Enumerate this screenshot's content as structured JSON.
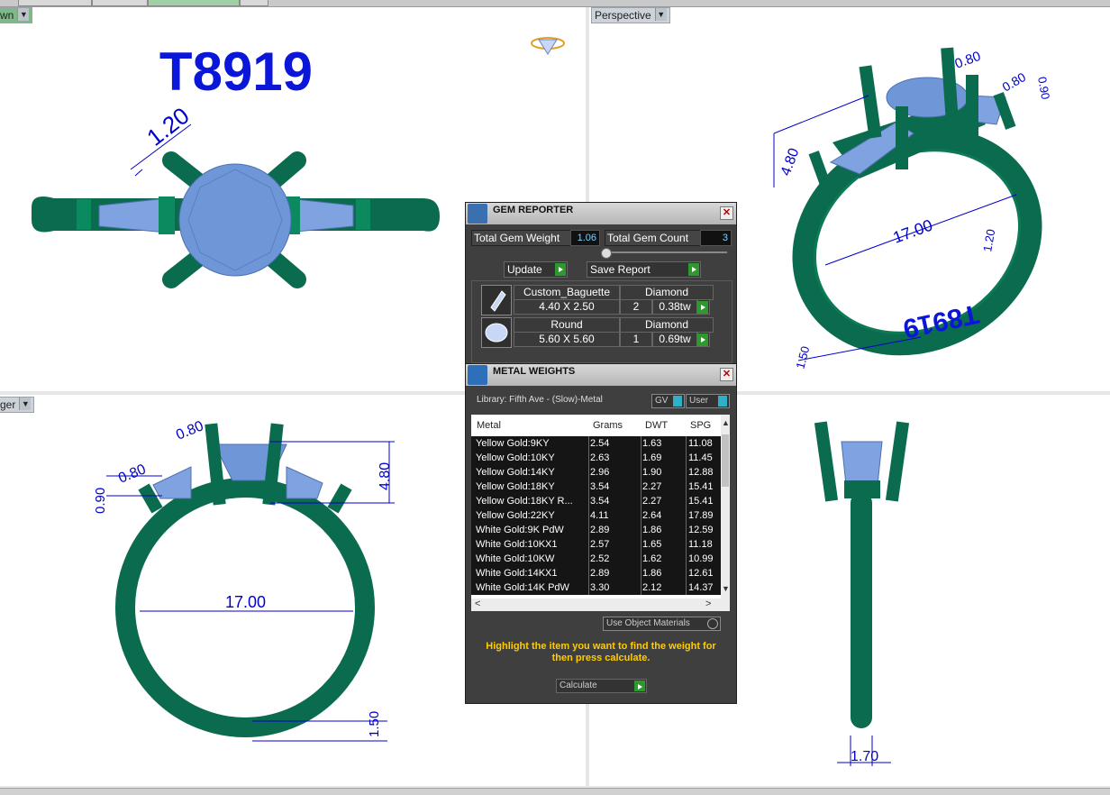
{
  "viewports": {
    "top_left": {
      "label": "wn",
      "part_number": "T8919"
    },
    "top_right": {
      "label": "Perspective",
      "engraving": "T8919"
    },
    "bottom_left": {
      "label": "ger"
    },
    "bottom_right": {}
  },
  "dimensions": {
    "prong_1": "1.20",
    "tr_prong_a": "0.80",
    "tr_prong_b": "0.80",
    "tr_prong_c": "0.90",
    "tr_height": "4.80",
    "tr_diameter": "17.00",
    "tr_shank_a": "1.20",
    "tr_shank_b": "1.50",
    "bl_prong_a": "0.80",
    "bl_prong_b": "0.80",
    "bl_prong_c": "0.90",
    "bl_height": "4.80",
    "bl_diameter": "17.00",
    "bl_shank": "1.50",
    "br_width": "1.70"
  },
  "gem_reporter": {
    "title": "GEM REPORTER",
    "total_weight_label": "Total Gem Weight",
    "total_weight_value": "1.06",
    "total_count_label": "Total Gem Count",
    "total_count_value": "3",
    "update_label": "Update",
    "save_report_label": "Save Report",
    "gems": [
      {
        "cut": "Custom_Baguette",
        "material": "Diamond",
        "size": "4.40 X 2.50",
        "count": "2",
        "weight": "0.38tw"
      },
      {
        "cut": "Round",
        "material": "Diamond",
        "size": "5.60 X 5.60",
        "count": "1",
        "weight": "0.69tw"
      }
    ]
  },
  "metal_weights": {
    "title": "METAL WEIGHTS",
    "library": "Library: Fifth Ave - (Slow)-Metal",
    "gv_label": "GV",
    "user_label": "User",
    "columns": [
      "Metal",
      "Grams",
      "DWT",
      "SPG"
    ],
    "rows": [
      [
        "Yellow Gold:9KY",
        "2.54",
        "1.63",
        "11.08"
      ],
      [
        "Yellow Gold:10KY",
        "2.63",
        "1.69",
        "11.45"
      ],
      [
        "Yellow Gold:14KY",
        "2.96",
        "1.90",
        "12.88"
      ],
      [
        "Yellow Gold:18KY",
        "3.54",
        "2.27",
        "15.41"
      ],
      [
        "Yellow Gold:18KY R...",
        "3.54",
        "2.27",
        "15.41"
      ],
      [
        "Yellow Gold:22KY",
        "4.11",
        "2.64",
        "17.89"
      ],
      [
        "White Gold:9K PdW",
        "2.89",
        "1.86",
        "12.59"
      ],
      [
        "White Gold:10KX1",
        "2.57",
        "1.65",
        "11.18"
      ],
      [
        "White Gold:10KW",
        "2.52",
        "1.62",
        "10.99"
      ],
      [
        "White Gold:14KX1",
        "2.89",
        "1.86",
        "12.61"
      ],
      [
        "White Gold:14K PdW",
        "3.30",
        "2.12",
        "14.37"
      ]
    ],
    "use_object_materials_label": "Use Object Materials",
    "hint": "Highlight the item you want to find the weight for then press calculate.",
    "calculate_label": "Calculate"
  },
  "colors": {
    "metal": "#0b6b4e",
    "gem": "#6f97d8",
    "dimension": "#0000cc",
    "panel": "#3f3f3f"
  }
}
